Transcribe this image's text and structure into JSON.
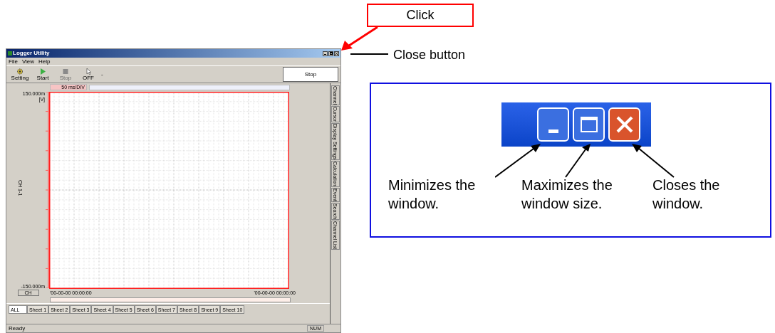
{
  "window": {
    "title": "Logger Utility",
    "menu": [
      "File",
      "View",
      "Help"
    ],
    "toolbar": [
      {
        "kind": "gear",
        "label": "Setting",
        "disabled": false
      },
      {
        "kind": "play",
        "label": "Start",
        "disabled": false
      },
      {
        "kind": "stop",
        "label": "Stop",
        "disabled": true
      },
      {
        "kind": "cursor",
        "label": "OFF",
        "disabled": false
      }
    ],
    "toolbar_extra": "-",
    "status_panel": "Stop",
    "time_div": "50 ms/DIV",
    "side_tabs": [
      "Channel",
      "Cursor",
      "Display Settings",
      "Calculation",
      "Event",
      "Search",
      "Channel List"
    ],
    "graph": {
      "y_max": "150.000m",
      "y_unit": "[V]",
      "y_min": "-150.000m",
      "channel_label": "CH 1-1",
      "ch_button": "CH",
      "time_start": "'00-00-00 00:00:00",
      "time_end": "'00-00-00 00:00:00"
    },
    "sheet_tabs": [
      {
        "label": "ALL",
        "selected": true
      },
      {
        "label": "Sheet 1",
        "selected": false
      },
      {
        "label": "Sheet 2",
        "selected": false
      },
      {
        "label": "Sheet 3",
        "selected": false
      },
      {
        "label": "Sheet 4",
        "selected": false
      },
      {
        "label": "Sheet 5",
        "selected": false
      },
      {
        "label": "Sheet 6",
        "selected": false
      },
      {
        "label": "Sheet 7",
        "selected": false
      },
      {
        "label": "Sheet 8",
        "selected": false
      },
      {
        "label": "Sheet 9",
        "selected": false
      },
      {
        "label": "Sheet 10",
        "selected": false
      }
    ],
    "status_bar": {
      "text": "Ready",
      "indicator": "NUM"
    }
  },
  "annotations": {
    "click": "Click",
    "close_button": "Close button",
    "buttons": [
      {
        "kind": "minimize",
        "caption": "Minimizes the window."
      },
      {
        "kind": "maximize",
        "caption": "Maximizes the window size."
      },
      {
        "kind": "close",
        "caption": "Closes the window."
      }
    ]
  }
}
